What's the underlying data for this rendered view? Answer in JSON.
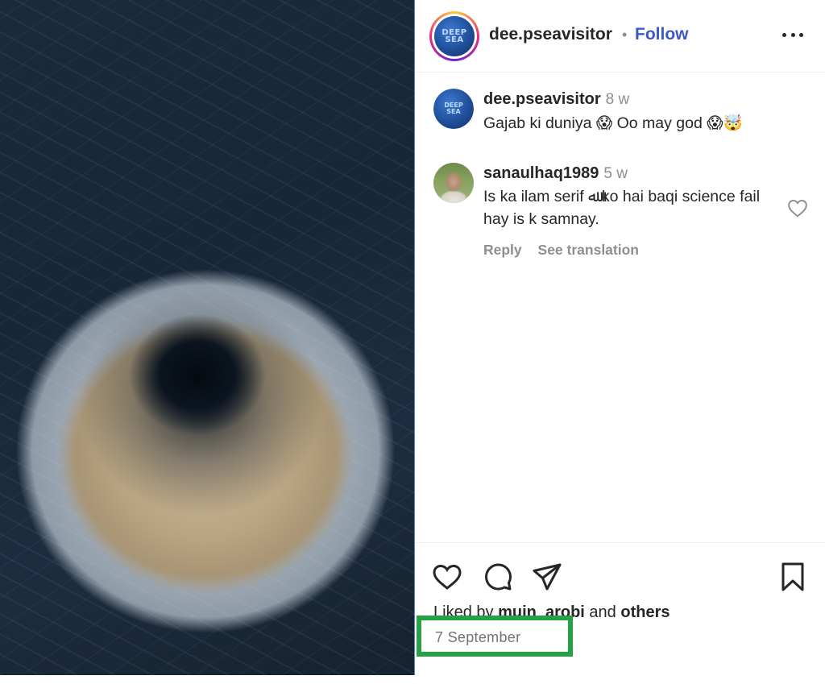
{
  "post": {
    "username": "dee.pseavisitor",
    "separator": "•",
    "follow_label": "Follow",
    "more_icon": "more-horizontal-icon",
    "logo_lines": [
      "DEEP",
      "SEA"
    ]
  },
  "comments": [
    {
      "username": "dee.pseavisitor",
      "time": "8 w",
      "text": "Gajab ki duniya 😱 Oo may god 😱🤯"
    },
    {
      "username": "sanaulhaq1989",
      "time": "5 w",
      "text": "Is ka ilam serif ﷲ ko hai baqi science fail hay is k samnay.",
      "actions": {
        "reply": "Reply",
        "translate": "See translation"
      }
    }
  ],
  "action_bar": {
    "icons": [
      "heart-icon",
      "comment-icon",
      "share-icon",
      "bookmark-icon"
    ],
    "liked_prefix": "Liked by",
    "liked_user": "muin_arobi",
    "liked_and": "and",
    "liked_others": "others",
    "date": "7 September"
  },
  "colors": {
    "follow": "#3b57c8",
    "highlight_box": "#25a244",
    "muted_text": "#8e8e8e"
  }
}
